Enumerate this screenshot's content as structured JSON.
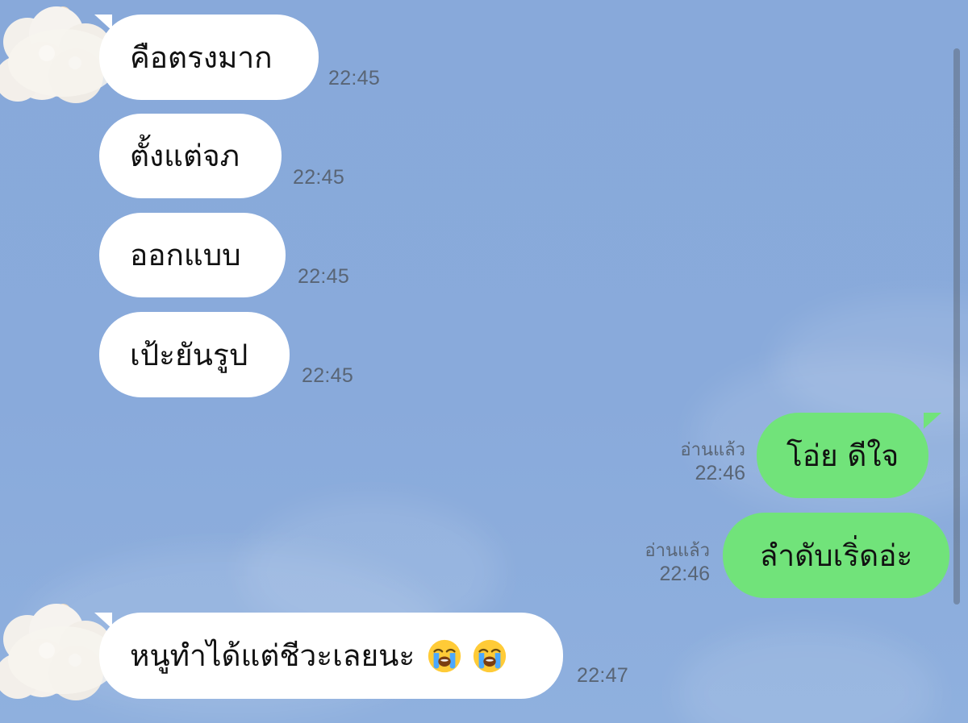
{
  "messages": [
    {
      "side": "incoming",
      "text": "คือตรงมาก",
      "time": "22:45",
      "avatar": "cloud-avatar-icon"
    },
    {
      "side": "incoming",
      "text": "ตั้งแต่จภ",
      "time": "22:45"
    },
    {
      "side": "incoming",
      "text": "ออกแบบ",
      "time": "22:45"
    },
    {
      "side": "incoming",
      "text": "เป้ะยันรูป",
      "time": "22:45"
    },
    {
      "side": "outgoing",
      "text": "โอ่ย ดีใจ",
      "read": "อ่านแล้ว",
      "time": "22:46"
    },
    {
      "side": "outgoing",
      "text": "ลำดับเริ่ดอ่ะ",
      "read": "อ่านแล้ว",
      "time": "22:46"
    },
    {
      "side": "incoming",
      "text": "หนูทำได้แต่ชีวะเลยนะ",
      "emoji": [
        "loudly-crying-face-icon",
        "loudly-crying-face-icon"
      ],
      "time": "22:47",
      "avatar": "cloud-avatar-icon"
    }
  ],
  "colors": {
    "background": "#88a9da",
    "incoming_bubble": "#ffffff",
    "outgoing_bubble": "#71e37a",
    "meta_text": "#596575"
  }
}
